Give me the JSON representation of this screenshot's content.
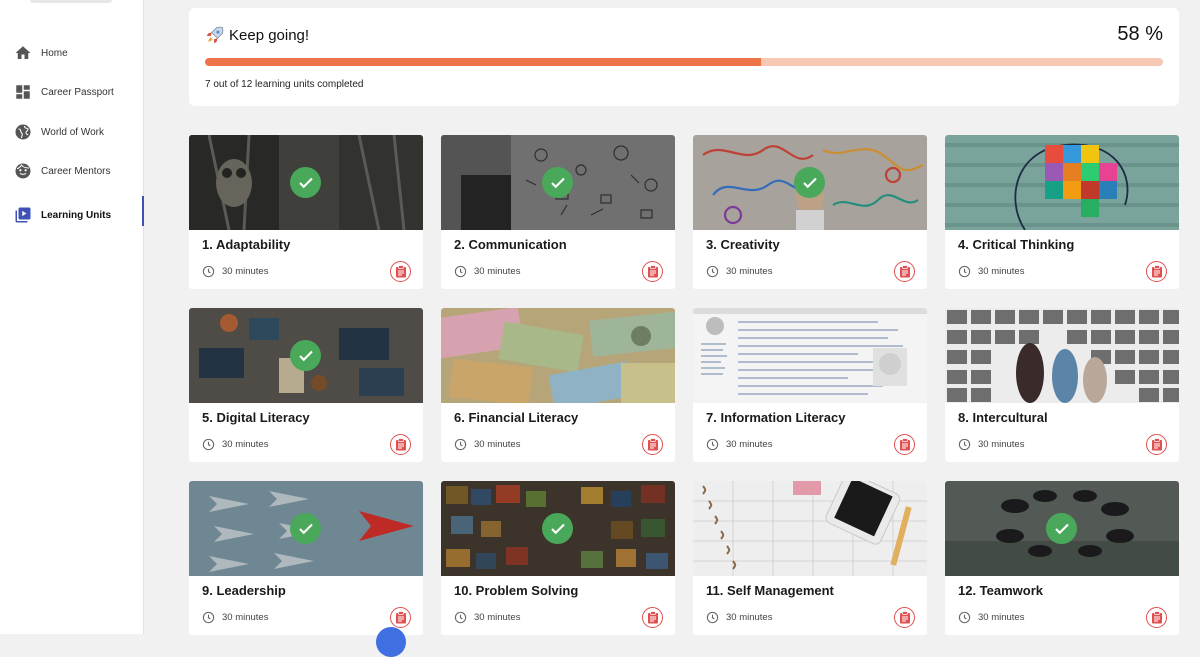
{
  "sidebar": {
    "items": [
      {
        "label": "Home",
        "icon": "home-icon"
      },
      {
        "label": "Career Passport",
        "icon": "dashboard-icon"
      },
      {
        "label": "World of Work",
        "icon": "globe-icon"
      },
      {
        "label": "Career Mentors",
        "icon": "mentor-face-icon"
      },
      {
        "label": "Learning Units",
        "icon": "play-library-icon",
        "active": true
      }
    ]
  },
  "progress": {
    "title": "Keep going!",
    "percent_label": "58 %",
    "percent": 58,
    "caption": "7 out of 12 learning units completed",
    "fill_color": "#ec7446",
    "track_color": "#f7c8b2"
  },
  "units": [
    {
      "title": "1. Adaptability",
      "duration": "30 minutes",
      "completed": true
    },
    {
      "title": "2. Communication",
      "duration": "30 minutes",
      "completed": true
    },
    {
      "title": "3. Creativity",
      "duration": "30 minutes",
      "completed": true
    },
    {
      "title": "4. Critical Thinking",
      "duration": "30 minutes",
      "completed": false
    },
    {
      "title": "5. Digital Literacy",
      "duration": "30 minutes",
      "completed": true
    },
    {
      "title": "6. Financial Literacy",
      "duration": "30 minutes",
      "completed": false
    },
    {
      "title": "7. Information Literacy",
      "duration": "30 minutes",
      "completed": false
    },
    {
      "title": "8. Intercultural",
      "duration": "30 minutes",
      "completed": false
    },
    {
      "title": "9. Leadership",
      "duration": "30 minutes",
      "completed": true
    },
    {
      "title": "10. Problem Solving",
      "duration": "30 minutes",
      "completed": true
    },
    {
      "title": "11. Self Management",
      "duration": "30 minutes",
      "completed": false
    },
    {
      "title": "12. Teamwork",
      "duration": "30 minutes",
      "completed": true
    }
  ],
  "colors": {
    "check": "#49a85a",
    "accent": "#3f51b5",
    "clipboard": "#e05050"
  }
}
